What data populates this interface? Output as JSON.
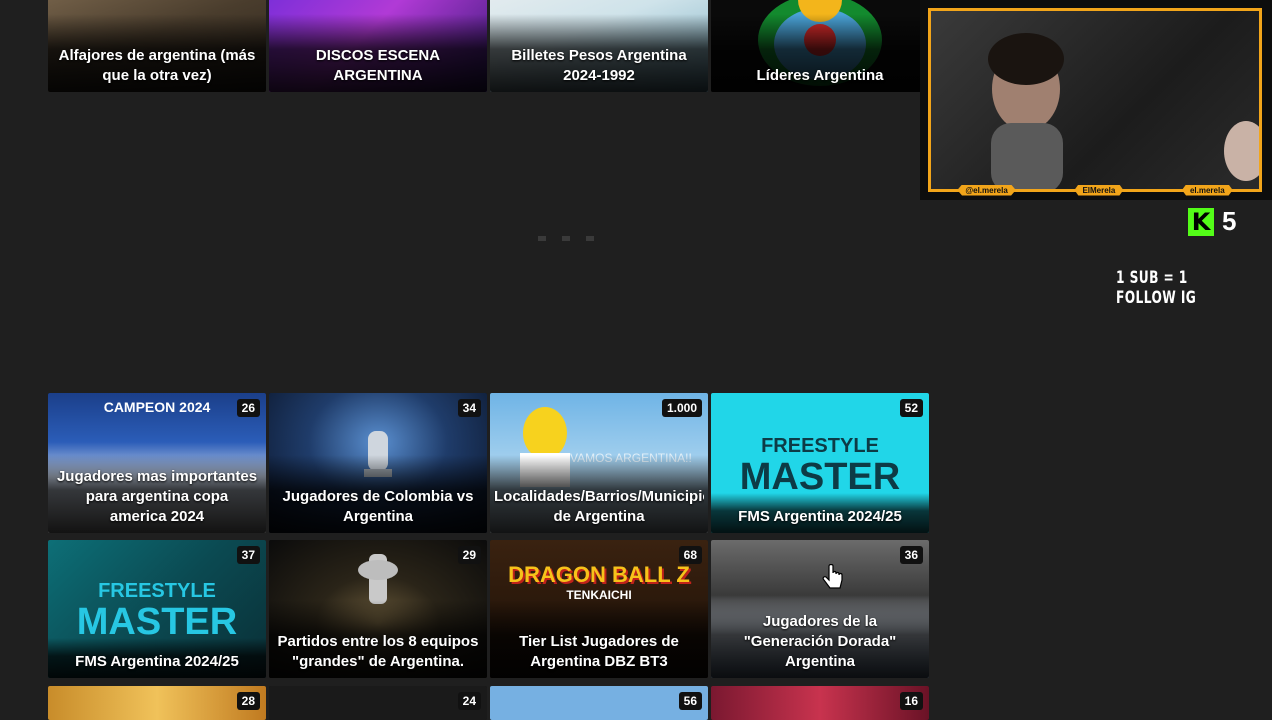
{
  "top_row": [
    {
      "title": "Alfajores de argentina (más\nque la otra vez)"
    },
    {
      "title": "DISCOS ESCENA\nARGENTINA"
    },
    {
      "title": "Billetes Pesos Argentina\n2024-1992"
    },
    {
      "title": "Líderes Argentina"
    }
  ],
  "grid": [
    {
      "title": "Jugadores mas importantes\npara argentina copa\namerica 2024",
      "count": "26"
    },
    {
      "title": "Jugadores de Colombia vs\nArgentina",
      "count": "34"
    },
    {
      "title": "Localidades/Barrios/Municipios\nde Argentina",
      "count": "1.000"
    },
    {
      "title": "FMS Argentina 2024/25",
      "count": "52"
    },
    {
      "title": "FMS Argentina 2024/25",
      "count": "37"
    },
    {
      "title": "Partidos entre los 8 equipos\n\"grandes\" de Argentina.",
      "count": "29"
    },
    {
      "title": "Tier List Jugadores de\nArgentina DBZ BT3",
      "count": "68"
    },
    {
      "title": "Jugadores de la\n\"Generación Dorada\"\nArgentina",
      "count": "36"
    },
    {
      "title": "",
      "count": "28"
    },
    {
      "title": "",
      "count": "24"
    },
    {
      "title": "",
      "count": "56"
    },
    {
      "title": "",
      "count": "16"
    }
  ],
  "thumb_text": {
    "campeon": "CAMPEON 2024",
    "fms_1": "FREESTYLE",
    "fms_2": "MASTER",
    "simpsons": "VAMOS ARGENTINA!!",
    "dbz": "DRAGON BALL Z",
    "dbz_sub": "TENKAICHI"
  },
  "overlay": {
    "socials": [
      "@el.merela",
      "ElMerela",
      "el.merela"
    ],
    "kick_count": "5",
    "sub_text": "1 SUB = 1 FOLLOW IG"
  }
}
